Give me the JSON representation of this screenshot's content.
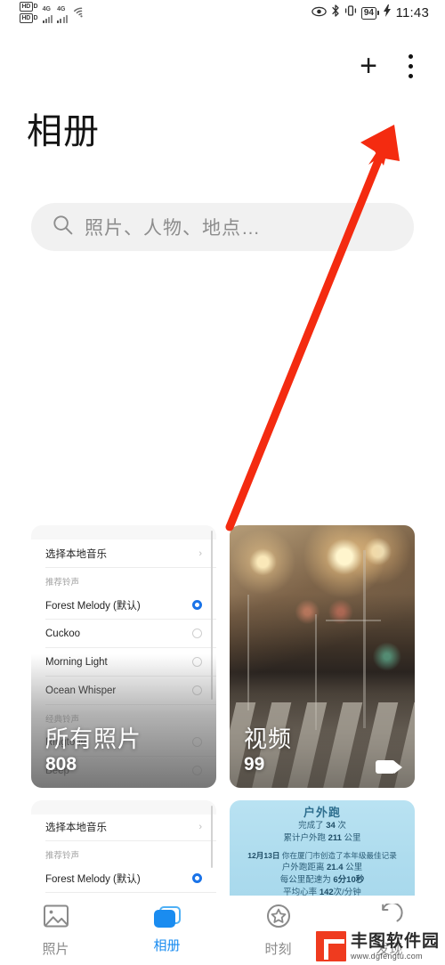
{
  "status_bar": {
    "hd_badge": "HD",
    "hd_sub": "D",
    "network_1": "4G",
    "network_2": "4G",
    "wifi_icon": "wifi-icon",
    "eye_icon": "eye-icon",
    "bluetooth_icon": "bluetooth-icon",
    "vibrate_icon": "vibrate-icon",
    "battery_level": "94",
    "charging_icon": "charging-bolt-icon",
    "time": "11:43"
  },
  "header": {
    "title": "相册",
    "add_label": "+",
    "menu_icon": "more-vertical-icon"
  },
  "search": {
    "icon": "search-icon",
    "placeholder": "照片、人物、地点…"
  },
  "albums": [
    {
      "name": "所有照片",
      "count": "808",
      "thumb_type": "ringtone-settings-screenshot"
    },
    {
      "name": "视频",
      "count": "99",
      "thumb_type": "night-street-photo",
      "badge_icon": "video-camera-icon"
    }
  ],
  "ringtone_thumb": {
    "local_music_row": "选择本地音乐",
    "chevron": "›",
    "section_recommended": "推荐铃声",
    "section_classic": "经典铃声",
    "items": [
      {
        "label": "Forest Melody (默认)",
        "selected": true
      },
      {
        "label": "Cuckoo",
        "selected": false
      },
      {
        "label": "Morning Light",
        "selected": false
      },
      {
        "label": "Ocean Whisper",
        "selected": false
      },
      {
        "label": "Ringtone",
        "selected": false
      },
      {
        "label": "Beep",
        "selected": false
      }
    ]
  },
  "fitness_card": {
    "title": "户外跑",
    "line1_pre": "完成了 ",
    "line1_num": "34",
    "line1_post": " 次",
    "line2_pre": "累计户外跑 ",
    "line2_num": "211",
    "line2_post": " 公里",
    "line3_date": "12月13日",
    "line3_text": " 你在厦门市创造了本年级最佳记录",
    "line4_pre": "户外跑距离 ",
    "line4_num": "21.4",
    "line4_post": " 公里",
    "line5_pre": "每公里配速为 ",
    "line5_num": "6分10秒",
    "line6_pre": "平均心率 ",
    "line6_num": "142",
    "line6_post": "次/分钟"
  },
  "tabbar": {
    "items": [
      {
        "label": "照片",
        "icon": "photo-icon",
        "active": false
      },
      {
        "label": "相册",
        "icon": "albums-icon",
        "active": true
      },
      {
        "label": "时刻",
        "icon": "star-moments-icon",
        "active": false
      },
      {
        "label": "发现",
        "icon": "discover-icon",
        "active": false
      }
    ]
  },
  "annotations": {
    "highlight_box": "red-highlight-rectangle",
    "arrow": "red-arrow-pointing-to-menu",
    "accent_color": "#f42b10"
  },
  "watermark": {
    "name": "丰图软件园",
    "url": "www.dgfengtu.com"
  }
}
